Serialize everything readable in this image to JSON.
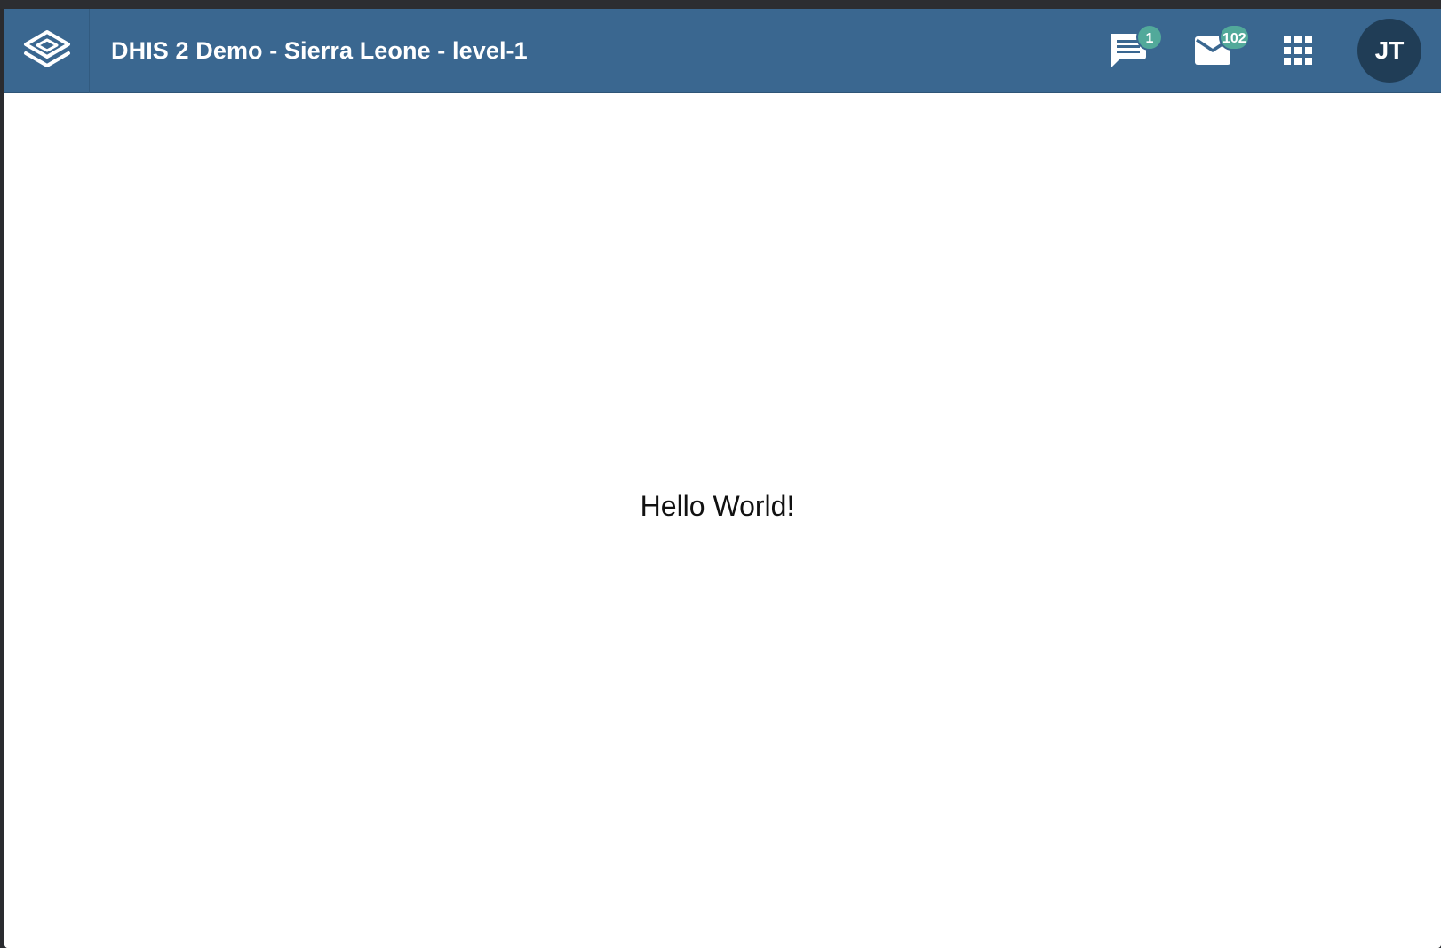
{
  "header": {
    "title": "DHIS 2 Demo - Sierra Leone - level-1",
    "logo_icon": "dhis2-logo-icon",
    "interpretations": {
      "icon": "chat-icon",
      "badge_count": "1"
    },
    "messages": {
      "icon": "mail-icon",
      "badge_count": "102"
    },
    "apps": {
      "icon": "apps-grid-icon"
    },
    "profile": {
      "initials": "JT"
    }
  },
  "main": {
    "text": "Hello World!"
  },
  "colors": {
    "header_bg": "#3a6790",
    "badge_bg": "#52a99a",
    "avatar_bg": "#203d56"
  }
}
